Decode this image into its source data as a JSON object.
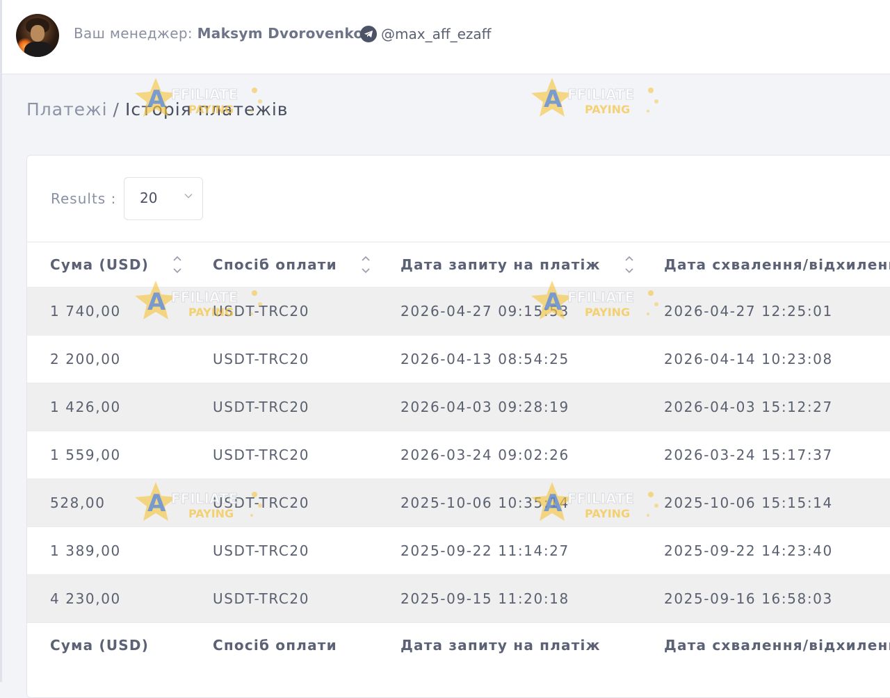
{
  "header": {
    "manager_label": "Ваш менеджер:",
    "manager_name": "Maksym Dvorovenko",
    "telegram_handle": "@max_aff_ezaff"
  },
  "breadcrumb": {
    "root": "Платежі",
    "separator": "/",
    "current": "Історія платежів"
  },
  "results": {
    "label": "Results :",
    "selected": "20"
  },
  "table": {
    "columns": [
      "Сума (USD)",
      "Спосіб оплати",
      "Дата запиту на платіж",
      "Дата схвалення/відхилення"
    ],
    "footer_columns": [
      "Сума (USD)",
      "Спосіб оплати",
      "Дата запиту на платіж",
      "Дата схвалення/відхилення г"
    ],
    "rows": [
      [
        "1 740,00",
        "USDT-TRC20",
        "2026-04-27 09:15:53",
        "2026-04-27 12:25:01"
      ],
      [
        "2 200,00",
        "USDT-TRC20",
        "2026-04-13 08:54:25",
        "2026-04-14 10:23:08"
      ],
      [
        "1 426,00",
        "USDT-TRC20",
        "2026-04-03 09:28:19",
        "2026-04-03 15:12:27"
      ],
      [
        "1 559,00",
        "USDT-TRC20",
        "2026-03-24 09:02:26",
        "2026-03-24 15:17:37"
      ],
      [
        "528,00",
        "USDT-TRC20",
        "2025-10-06 10:35:14",
        "2025-10-06 15:15:14"
      ],
      [
        "1 389,00",
        "USDT-TRC20",
        "2025-09-22 11:14:27",
        "2025-09-22 14:23:40"
      ],
      [
        "4 230,00",
        "USDT-TRC20",
        "2025-09-15 11:20:18",
        "2025-09-16 16:58:03"
      ]
    ]
  },
  "watermark": {
    "line1": "AFFILIATE",
    "line2": "PAYING"
  },
  "colors": {
    "shaded_row": "#efefef",
    "text": "#5a6070",
    "watermark_gold": "#f5c542",
    "watermark_blue": "#4a7fd6"
  },
  "icons": [
    "telegram-icon",
    "chevron-down-icon",
    "sort-icon",
    "avatar"
  ]
}
